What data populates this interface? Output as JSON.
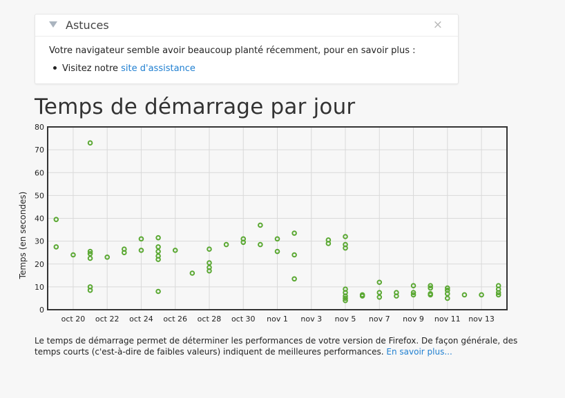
{
  "tips": {
    "title": "Astuces",
    "close_glyph": "×",
    "message": "Votre navigateur semble avoir beaucoup planté récemment, pour en savoir plus :",
    "item_prefix": "Visitez notre ",
    "item_link": "site d'assistance"
  },
  "page_title": "Temps de démarrage par jour",
  "description": {
    "text": "Le temps de démarrage permet de déterminer les performances de votre version de Firefox. De façon générale, des temps courts (c'est-à-dire de faibles valeurs) indiquent de meilleures performances. ",
    "link": "En savoir plus..."
  },
  "colors": {
    "point": "#5aa832",
    "grid": "#d9d9d9",
    "frame": "#333333",
    "link": "#1f7fd1"
  },
  "chart_data": {
    "type": "scatter",
    "ylabel": "Temps (en secondes)",
    "xlabel": "",
    "ylim": [
      0,
      80
    ],
    "yticks": [
      0,
      10,
      20,
      30,
      40,
      50,
      60,
      70,
      80
    ],
    "xlim": [
      "2013-10-18T12:00",
      "2013-11-14T12:00"
    ],
    "xticks": [
      "2013-10-20",
      "2013-10-22",
      "2013-10-24",
      "2013-10-26",
      "2013-10-28",
      "2013-10-30",
      "2013-11-01",
      "2013-11-03",
      "2013-11-05",
      "2013-11-07",
      "2013-11-09",
      "2013-11-11",
      "2013-11-13"
    ],
    "xtick_labels": [
      "oct 20",
      "oct 22",
      "oct 24",
      "oct 26",
      "oct 28",
      "oct 30",
      "nov 1",
      "nov 3",
      "nov 5",
      "nov 7",
      "nov 9",
      "nov 11",
      "nov 13"
    ],
    "grid": true,
    "points": [
      {
        "x": "2013-10-19",
        "y": 39.5
      },
      {
        "x": "2013-10-19",
        "y": 27.5
      },
      {
        "x": "2013-10-20",
        "y": 24
      },
      {
        "x": "2013-10-21",
        "y": 73
      },
      {
        "x": "2013-10-21",
        "y": 25.5
      },
      {
        "x": "2013-10-21",
        "y": 24.5
      },
      {
        "x": "2013-10-21",
        "y": 22.5
      },
      {
        "x": "2013-10-21",
        "y": 10
      },
      {
        "x": "2013-10-21",
        "y": 8.5
      },
      {
        "x": "2013-10-22",
        "y": 23
      },
      {
        "x": "2013-10-23",
        "y": 26.5
      },
      {
        "x": "2013-10-23",
        "y": 25
      },
      {
        "x": "2013-10-24",
        "y": 31
      },
      {
        "x": "2013-10-24",
        "y": 26
      },
      {
        "x": "2013-10-25",
        "y": 31.5
      },
      {
        "x": "2013-10-25",
        "y": 27.5
      },
      {
        "x": "2013-10-25",
        "y": 25.5
      },
      {
        "x": "2013-10-25",
        "y": 23.5
      },
      {
        "x": "2013-10-25",
        "y": 22
      },
      {
        "x": "2013-10-25",
        "y": 8
      },
      {
        "x": "2013-10-26",
        "y": 26
      },
      {
        "x": "2013-10-27",
        "y": 16
      },
      {
        "x": "2013-10-28",
        "y": 26.5
      },
      {
        "x": "2013-10-28",
        "y": 20.5
      },
      {
        "x": "2013-10-28",
        "y": 18.5
      },
      {
        "x": "2013-10-28",
        "y": 17
      },
      {
        "x": "2013-10-29",
        "y": 28.5
      },
      {
        "x": "2013-10-30",
        "y": 31
      },
      {
        "x": "2013-10-30",
        "y": 29.5
      },
      {
        "x": "2013-10-31",
        "y": 37
      },
      {
        "x": "2013-10-31",
        "y": 28.5
      },
      {
        "x": "2013-11-01",
        "y": 31
      },
      {
        "x": "2013-11-01",
        "y": 25.5
      },
      {
        "x": "2013-11-02",
        "y": 33.5
      },
      {
        "x": "2013-11-02",
        "y": 24
      },
      {
        "x": "2013-11-02",
        "y": 13.5
      },
      {
        "x": "2013-11-04",
        "y": 30.5
      },
      {
        "x": "2013-11-04",
        "y": 29
      },
      {
        "x": "2013-11-05",
        "y": 32
      },
      {
        "x": "2013-11-05",
        "y": 28.5
      },
      {
        "x": "2013-11-05",
        "y": 27
      },
      {
        "x": "2013-11-05",
        "y": 9
      },
      {
        "x": "2013-11-05",
        "y": 7.5
      },
      {
        "x": "2013-11-05",
        "y": 6
      },
      {
        "x": "2013-11-05",
        "y": 5
      },
      {
        "x": "2013-11-05",
        "y": 4
      },
      {
        "x": "2013-11-06",
        "y": 6.5
      },
      {
        "x": "2013-11-06",
        "y": 6
      },
      {
        "x": "2013-11-07",
        "y": 12
      },
      {
        "x": "2013-11-07",
        "y": 7.5
      },
      {
        "x": "2013-11-07",
        "y": 5.5
      },
      {
        "x": "2013-11-08",
        "y": 7.5
      },
      {
        "x": "2013-11-08",
        "y": 6
      },
      {
        "x": "2013-11-09",
        "y": 10.5
      },
      {
        "x": "2013-11-09",
        "y": 7.5
      },
      {
        "x": "2013-11-09",
        "y": 6.5
      },
      {
        "x": "2013-11-10",
        "y": 10.5
      },
      {
        "x": "2013-11-10",
        "y": 9.5
      },
      {
        "x": "2013-11-10",
        "y": 7
      },
      {
        "x": "2013-11-10",
        "y": 6.5
      },
      {
        "x": "2013-11-11",
        "y": 9.5
      },
      {
        "x": "2013-11-11",
        "y": 8.5
      },
      {
        "x": "2013-11-11",
        "y": 7
      },
      {
        "x": "2013-11-11",
        "y": 5
      },
      {
        "x": "2013-11-12",
        "y": 6.5
      },
      {
        "x": "2013-11-13",
        "y": 6.5
      },
      {
        "x": "2013-11-14",
        "y": 10.5
      },
      {
        "x": "2013-11-14",
        "y": 9
      },
      {
        "x": "2013-11-14",
        "y": 7.5
      },
      {
        "x": "2013-11-14",
        "y": 6.5
      }
    ]
  }
}
